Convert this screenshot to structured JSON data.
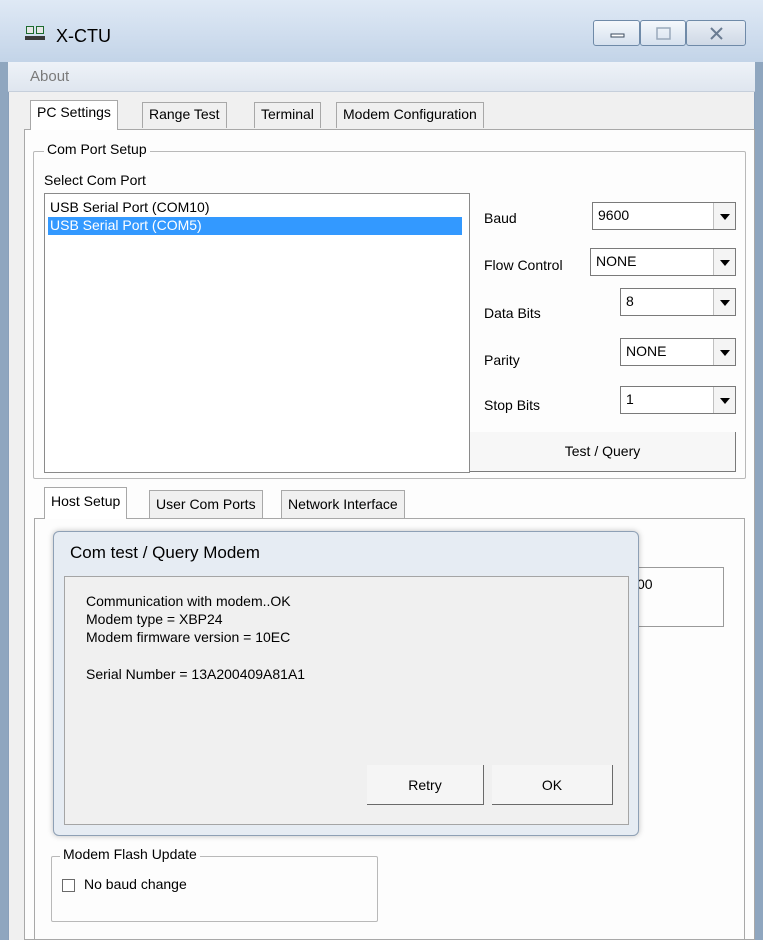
{
  "window": {
    "title": "X-CTU"
  },
  "menu": {
    "about": "About"
  },
  "tabs": [
    "PC Settings",
    "Range Test",
    "Terminal",
    "Modem Configuration"
  ],
  "com_setup": {
    "group_label": "Com Port Setup",
    "select_label": "Select Com Port",
    "ports": [
      "USB Serial Port (COM10)",
      "USB Serial Port (COM5)"
    ],
    "selected_index": 1,
    "baud_label": "Baud",
    "baud_value": "9600",
    "flow_label": "Flow Control",
    "flow_value": "NONE",
    "data_label": "Data Bits",
    "data_value": "8",
    "parity_label": "Parity",
    "parity_value": "NONE",
    "stop_label": "Stop Bits",
    "stop_value": "1",
    "test_button": "Test / Query"
  },
  "sub_tabs": [
    "Host Setup",
    "User Com Ports",
    "Network Interface"
  ],
  "background_partial": "00",
  "dialog": {
    "title": "Com test / Query Modem",
    "lines": [
      "Communication with modem..OK",
      "Modem type = XBP24",
      "Modem firmware version = 10EC",
      "",
      "Serial Number = 13A200409A81A1"
    ],
    "retry": "Retry",
    "ok": "OK"
  },
  "flash": {
    "group_label": "Modem Flash Update",
    "checkbox_label": "No baud change",
    "checked": false
  },
  "colors": {
    "selection": "#3399ff",
    "titlebar": "#c3d4e8"
  }
}
